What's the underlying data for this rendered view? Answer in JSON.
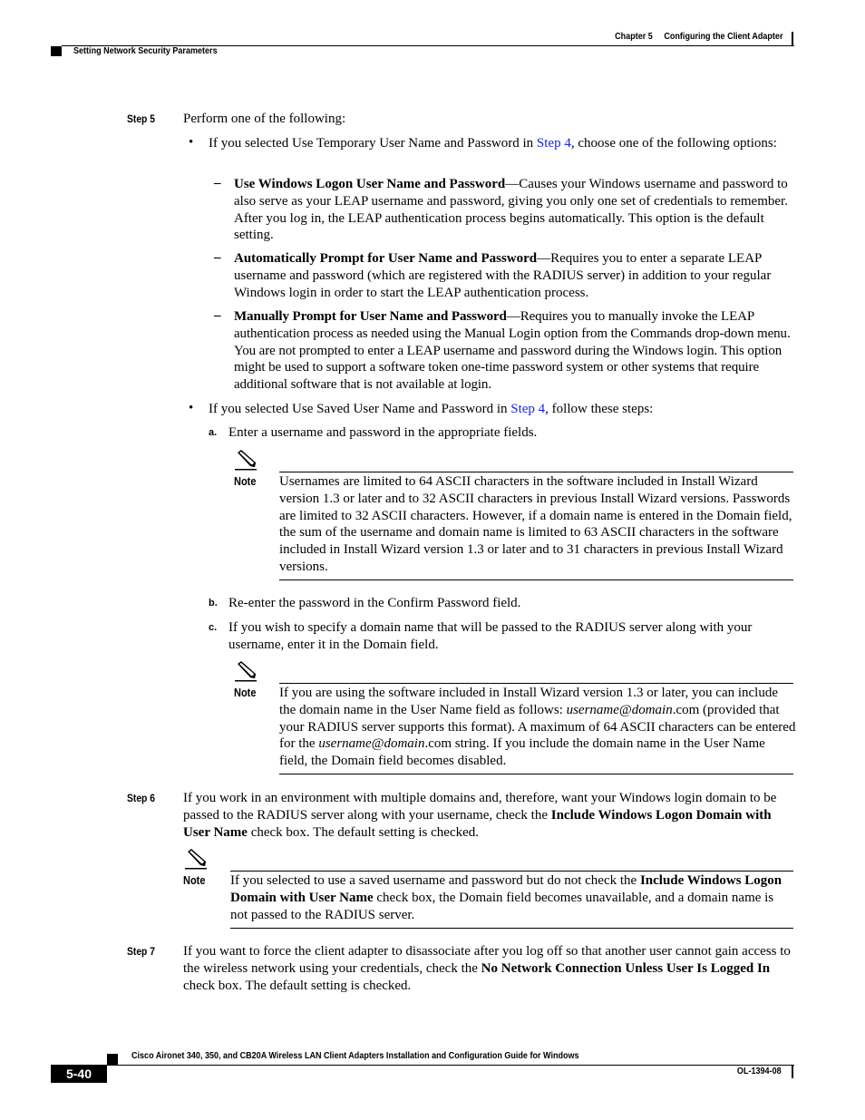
{
  "header": {
    "chapter": "Chapter 5",
    "chapter_title": "Configuring the Client Adapter",
    "section": "Setting Network Security Parameters"
  },
  "footer": {
    "book_title": "Cisco Aironet 340, 350, and CB20A Wireless LAN Client Adapters Installation and Configuration Guide for Windows",
    "page_number": "5-40",
    "doc_number": "OL-1394-08"
  },
  "link_color": "#1a22e8",
  "steps": {
    "step5": {
      "label": "Step 5",
      "intro": "Perform one of the following:",
      "bullet1": {
        "pre": "If you selected Use Temporary User Name and Password in ",
        "link": "Step 4",
        "post": ", choose one of the following options:",
        "options": [
          {
            "title": "Use Windows Logon User Name and Password",
            "text": "—Causes your Windows username and password to also serve as your LEAP username and password, giving you only one set of credentials to remember. After you log in, the LEAP authentication process begins automatically. This option is the default setting."
          },
          {
            "title": "Automatically Prompt for User Name and Password",
            "text": "—Requires you to enter a separate LEAP username and password (which are registered with the RADIUS server) in addition to your regular Windows login in order to start the LEAP authentication process."
          },
          {
            "title": "Manually Prompt for User Name and Password",
            "text": "—Requires you to manually invoke the LEAP authentication process as needed using the Manual Login option from the Commands drop-down menu. You are not prompted to enter a LEAP username and password during the Windows login. This option might be used to support a software token one-time password system or other systems that require additional software that is not available at login."
          }
        ]
      },
      "bullet2": {
        "pre": "If you selected Use Saved User Name and Password in ",
        "link": "Step 4",
        "post": ", follow these steps:",
        "substeps": [
          {
            "letter": "a.",
            "text": "Enter a username and password in the appropriate fields."
          },
          {
            "letter": "b.",
            "text": "Re-enter the password in the Confirm Password field."
          },
          {
            "letter": "c.",
            "text": "If you wish to specify a domain name that will be passed to the RADIUS server along with your username, enter it in the Domain field."
          }
        ],
        "note_a": {
          "label": "Note",
          "text": "Usernames are limited to 64 ASCII characters in the software included in Install Wizard version 1.3 or later and to 32 ASCII characters in previous Install Wizard versions. Passwords are limited to 32 ASCII characters. However, if a domain name is entered in the Domain field, the sum of the username and domain name is limited to 63 ASCII characters in the software included in Install Wizard version 1.3 or later and to 31 characters in previous Install Wizard versions."
        },
        "note_c": {
          "label": "Note",
          "p1": "If you are using the software included in Install Wizard version 1.3 or later, you can include the domain name in the User Name field as follows: ",
          "i1": "username@domain",
          "p2": ".com (provided that your RADIUS server supports this format). A maximum of 64 ASCII characters can be entered for the ",
          "i2": "username@domain",
          "p3": ".com string. If you include the domain name in the User Name field, the Domain field becomes disabled."
        }
      }
    },
    "step6": {
      "label": "Step 6",
      "pre": "If you work in an environment with multiple domains and, therefore, want your Windows login domain to be passed to the RADIUS server along with your username, check the ",
      "bold": "Include Windows Logon Domain with User Name",
      "post": " check box. The default setting is checked.",
      "note": {
        "label": "Note",
        "pre": "If you selected to use a saved username and password but do not check the ",
        "bold": "Include Windows Logon Domain with User Name",
        "post": " check box, the Domain field becomes unavailable, and a domain name is not passed to the RADIUS server."
      }
    },
    "step7": {
      "label": "Step 7",
      "pre": "If you want to force the client adapter to disassociate after you log off so that another user cannot gain access to the wireless network using your credentials, check the ",
      "bold": "No Network Connection Unless User Is Logged In",
      "post": " check box. The default setting is checked."
    }
  }
}
